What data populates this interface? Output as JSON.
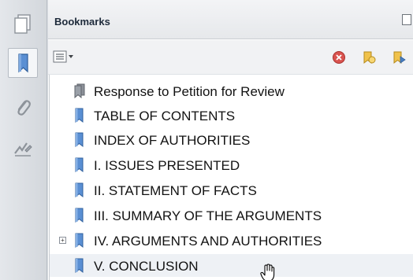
{
  "panel": {
    "title": "Bookmarks"
  },
  "bookmarks": [
    {
      "label": "Response to Petition for Review",
      "type": "document"
    },
    {
      "label": "TABLE OF CONTENTS",
      "type": "bookmark"
    },
    {
      "label": "INDEX OF AUTHORITIES",
      "type": "bookmark"
    },
    {
      "label": "I. ISSUES PRESENTED",
      "type": "bookmark"
    },
    {
      "label": "II. STATEMENT OF FACTS",
      "type": "bookmark"
    },
    {
      "label": "III. SUMMARY OF THE ARGUMENTS",
      "type": "bookmark"
    },
    {
      "label": "IV. ARGUMENTS AND AUTHORITIES",
      "type": "bookmark",
      "collapsed": true
    },
    {
      "label": "V. CONCLUSION",
      "type": "bookmark",
      "hovered": true
    }
  ],
  "icons": {
    "rail": [
      "pages-icon",
      "bookmarks-icon",
      "attachments-icon",
      "signatures-icon"
    ],
    "toolbar": [
      "options-menu-icon",
      "delete-bookmark-icon",
      "new-bookmark-icon",
      "expand-bookmark-icon"
    ]
  },
  "colors": {
    "bookmark_blue": "#4a7fc1",
    "delete_red": "#d9534f",
    "rail_bg": "#d9dde2"
  }
}
